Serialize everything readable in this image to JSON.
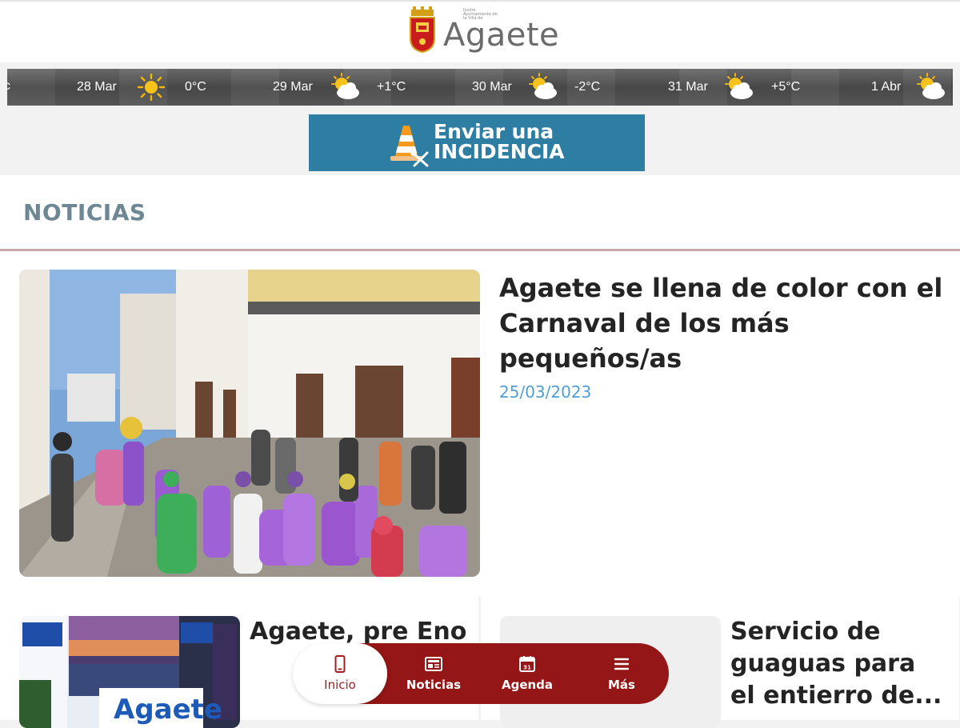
{
  "header": {
    "logo_small_lines": [
      "Ilustre",
      "Ayuntamiento de",
      "la Villa de"
    ],
    "logo_word": "Agaete"
  },
  "weather": {
    "items": [
      {
        "date": "28 Mar",
        "temp": "0°C",
        "icon": "sun-icon"
      },
      {
        "date": "29 Mar",
        "temp": "+1°C",
        "icon": "partly-cloudy-icon"
      },
      {
        "date": "30 Mar",
        "temp": "-2°C",
        "icon": "partly-cloudy-icon"
      },
      {
        "date": "31 Mar",
        "temp": "+5°C",
        "icon": "partly-cloudy-icon"
      },
      {
        "date": "1 Abr",
        "temp": "",
        "icon": "partly-cloudy-icon"
      }
    ]
  },
  "incidencia": {
    "line1": "Enviar una",
    "line2": "INCIDENCIA"
  },
  "news": {
    "section_title": "NOTICIAS",
    "featured": {
      "title": "Agaete se llena de color con el Carnaval de los más pequeños/as",
      "date": "25/03/2023"
    },
    "cards": [
      {
        "title": "Agaete, pre Eno"
      },
      {
        "title": "Servicio de guaguas para el entierro de..."
      }
    ]
  },
  "bottom_nav": {
    "items": [
      {
        "label": "Inicio",
        "icon": "phone-icon",
        "active": true
      },
      {
        "label": "Noticias",
        "icon": "newspaper-icon",
        "active": false
      },
      {
        "label": "Agenda",
        "icon": "calendar-icon",
        "active": false
      },
      {
        "label": "Más",
        "icon": "menu-icon",
        "active": false
      }
    ]
  },
  "colors": {
    "brand_red": "#941616",
    "incidencia_blue": "#2e7ea3",
    "section_title": "#6e8794",
    "date_blue": "#4f9fd6"
  }
}
